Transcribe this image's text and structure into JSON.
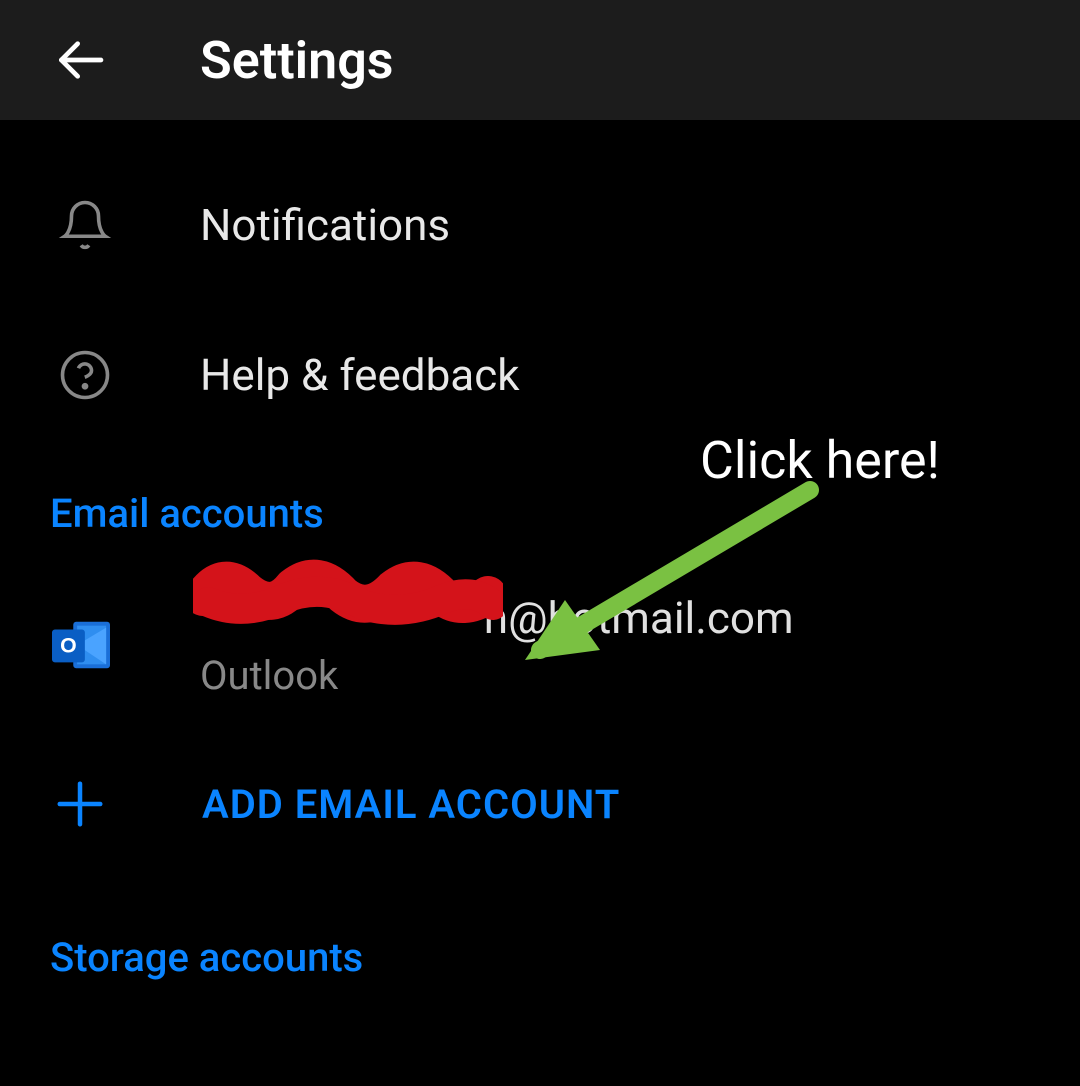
{
  "header": {
    "title": "Settings"
  },
  "menu": {
    "notifications": "Notifications",
    "help": "Help & feedback"
  },
  "sections": {
    "emailAccounts": "Email accounts",
    "storageAccounts": "Storage accounts"
  },
  "account": {
    "emailVisible": "n@hotmail.com",
    "provider": "Outlook"
  },
  "actions": {
    "addEmail": "ADD EMAIL ACCOUNT"
  },
  "annotation": {
    "label": "Click here!"
  }
}
